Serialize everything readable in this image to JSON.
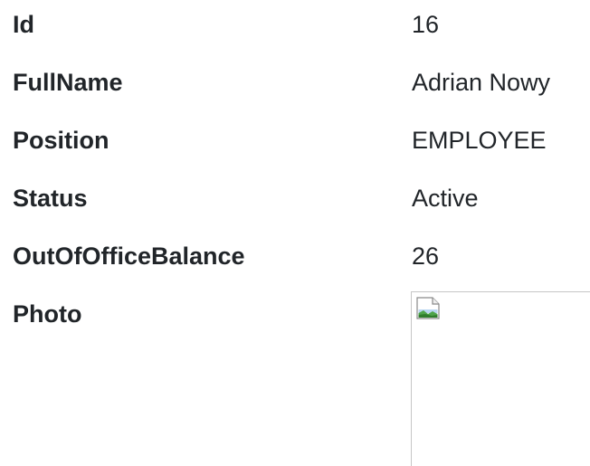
{
  "details": {
    "rows": [
      {
        "label": "Id",
        "value": "16"
      },
      {
        "label": "FullName",
        "value": "Adrian Nowy"
      },
      {
        "label": "Position",
        "value": "EMPLOYEE"
      },
      {
        "label": "Status",
        "value": "Active"
      },
      {
        "label": "OutOfOfficeBalance",
        "value": "26"
      },
      {
        "label": "Photo",
        "value": ""
      }
    ],
    "photo_icon": "broken-image-icon"
  }
}
